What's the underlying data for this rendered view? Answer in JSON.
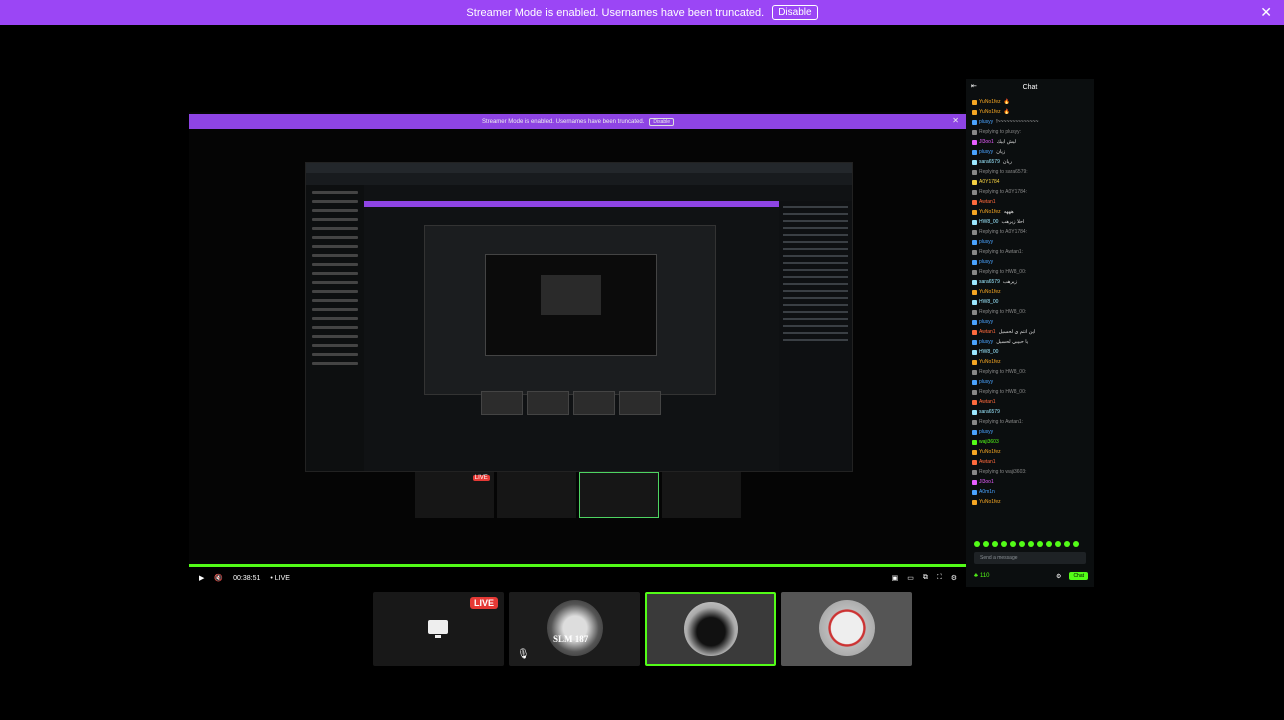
{
  "banner": {
    "text": "Streamer Mode is enabled. Usernames have been truncated.",
    "disable": "Disable",
    "close": "✕"
  },
  "inner_banner": {
    "text": "Streamer Mode is enabled. Usernames have been truncated.",
    "disable": "Disable"
  },
  "player": {
    "time": "00:38:51",
    "live_label": "• LIVE",
    "play": "▶",
    "volume": "🔇"
  },
  "tiles": [
    {
      "name": "screen-tile",
      "badge": "LIVE"
    },
    {
      "name": "slm-cam-tile",
      "caption": "SLM 187"
    },
    {
      "name": "cam-tile-2"
    },
    {
      "name": "cam-tile-3"
    }
  ],
  "chat": {
    "title": "Chat",
    "messages": [
      {
        "user": "YuNo1fez",
        "text": "🔥",
        "color": "#f5a623"
      },
      {
        "user": "YuNo1fez",
        "text": "🔥",
        "color": "#f5a623"
      },
      {
        "user": "plusyy",
        "text": "!~~~~~~~~~~~~~~",
        "color": "#4aa3ff"
      },
      {
        "user": "Replying to plusyy:",
        "text": "",
        "color": "#888"
      },
      {
        "user": "Jl3oo1",
        "text": "ليش ابيك",
        "color": "#e85dff"
      },
      {
        "user": "plusyy",
        "text": "زيان",
        "color": "#4aa3ff"
      },
      {
        "user": "sara6579",
        "text": "ريان",
        "color": "#9be8ff"
      },
      {
        "user": "Replying to sara6579:",
        "text": "",
        "color": "#888"
      },
      {
        "user": "A0Y1784",
        "text": "",
        "color": "#f5d142"
      },
      {
        "user": "Replying to A0Y1784:",
        "text": "",
        "color": "#888"
      },
      {
        "user": "Awtan1",
        "text": "",
        "color": "#ff6a3d"
      },
      {
        "user": "YuNo1fez",
        "text": "هههه",
        "color": "#f5a623"
      },
      {
        "user": "HW8_00",
        "text": "احلا زيرهب",
        "color": "#9be8ff"
      },
      {
        "user": "Replying to A0Y1784:",
        "text": "",
        "color": "#888"
      },
      {
        "user": "plusyy",
        "text": "",
        "color": "#4aa3ff"
      },
      {
        "user": "Replying to Awtan1:",
        "text": "",
        "color": "#888"
      },
      {
        "user": "plusyy",
        "text": "",
        "color": "#4aa3ff"
      },
      {
        "user": "Replying to HW8_00:",
        "text": "",
        "color": "#888"
      },
      {
        "user": "sara6579",
        "text": "زيرهب",
        "color": "#9be8ff"
      },
      {
        "user": "YuNo1fez",
        "text": "",
        "color": "#f5a623"
      },
      {
        "user": "HW8_00",
        "text": "",
        "color": "#9be8ff"
      },
      {
        "user": "Replying to HW8_00:",
        "text": "",
        "color": "#888"
      },
      {
        "user": "plusyy",
        "text": "",
        "color": "#4aa3ff"
      },
      {
        "user": "Awtan1",
        "text": "اين انتم ي لحسيل",
        "color": "#ff6a3d"
      },
      {
        "user": "plusyy",
        "text": "يا حبيبي لحسيل",
        "color": "#4aa3ff"
      },
      {
        "user": "HW8_00",
        "text": "",
        "color": "#9be8ff"
      },
      {
        "user": "YuNo1fez",
        "text": "",
        "color": "#f5a623"
      },
      {
        "user": "Replying to HW8_00:",
        "text": "",
        "color": "#888"
      },
      {
        "user": "plusyy",
        "text": "",
        "color": "#4aa3ff"
      },
      {
        "user": "Replying to HW8_00:",
        "text": "",
        "color": "#888"
      },
      {
        "user": "Awtan1",
        "text": "",
        "color": "#ff6a3d"
      },
      {
        "user": "sara6579",
        "text": "",
        "color": "#9be8ff"
      },
      {
        "user": "Replying to Awtan1:",
        "text": "",
        "color": "#888"
      },
      {
        "user": "plusyy",
        "text": "",
        "color": "#4aa3ff"
      },
      {
        "user": "waji3603",
        "text": "",
        "color": "#53fc18"
      },
      {
        "user": "YuNo1fez",
        "text": "",
        "color": "#f5a623"
      },
      {
        "user": "Awtan1",
        "text": "",
        "color": "#ff6a3d"
      },
      {
        "user": "Replying to waji3603:",
        "text": "",
        "color": "#888"
      },
      {
        "user": "Jl3oo1",
        "text": "",
        "color": "#e85dff"
      },
      {
        "user": "A0m1n",
        "text": "",
        "color": "#4aa3ff"
      },
      {
        "user": "YuNo1fez",
        "text": "",
        "color": "#f5a623"
      }
    ],
    "input_placeholder": "Send a message",
    "viewer_count": "110",
    "send_label": "Chat"
  }
}
